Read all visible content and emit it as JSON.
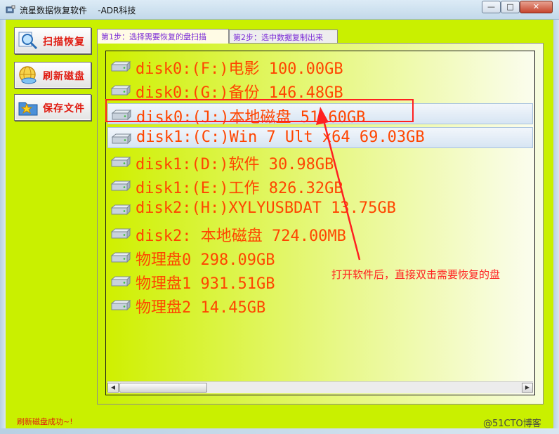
{
  "window": {
    "title": "流星数据恢复软件    -ADR科技",
    "minimize": "—",
    "maximize": "□",
    "close": "✕"
  },
  "sidebar": {
    "buttons": [
      {
        "label": "扫描恢复",
        "icon": "magnifier-icon"
      },
      {
        "label": "刷新磁盘",
        "icon": "globe-icon"
      },
      {
        "label": "保存文件",
        "icon": "folder-star-icon"
      }
    ]
  },
  "tabs": [
    {
      "label": "第1步：选择需要恢复的盘扫描",
      "selected": true
    },
    {
      "label": "第2步：选中数据复制出来",
      "selected": false
    }
  ],
  "disks": [
    {
      "label": "disk0:(F:)电影 100.00GB",
      "selected": false
    },
    {
      "label": "disk0:(G:)备份 146.48GB",
      "selected": false
    },
    {
      "label": "disk0:(J:)本地磁盘 51.60GB",
      "selected": true
    },
    {
      "label": "disk1:(C:)Win 7 Ult x64 69.03GB",
      "selected": true
    },
    {
      "label": "disk1:(D:)软件 30.98GB",
      "selected": false
    },
    {
      "label": "disk1:(E:)工作 826.32GB",
      "selected": false
    },
    {
      "label": "disk2:(H:)XYLYUSBDAT 13.75GB",
      "selected": false
    },
    {
      "label": "disk2:    本地磁盘 724.00MB",
      "selected": false
    },
    {
      "label": "物理盘0 298.09GB",
      "selected": false
    },
    {
      "label": "物理盘1 931.51GB",
      "selected": false
    },
    {
      "label": "物理盘2 14.45GB",
      "selected": false
    }
  ],
  "annotation": {
    "text": "打开软件后，直接双击需要恢复的盘"
  },
  "status": {
    "text": "刷新磁盘成功~!"
  },
  "watermark": "@51CTO博客",
  "colors": {
    "background": "#c9f000",
    "disk_text": "#ff4500",
    "annotation": "#ff2020",
    "button_label": "#e0190f"
  }
}
